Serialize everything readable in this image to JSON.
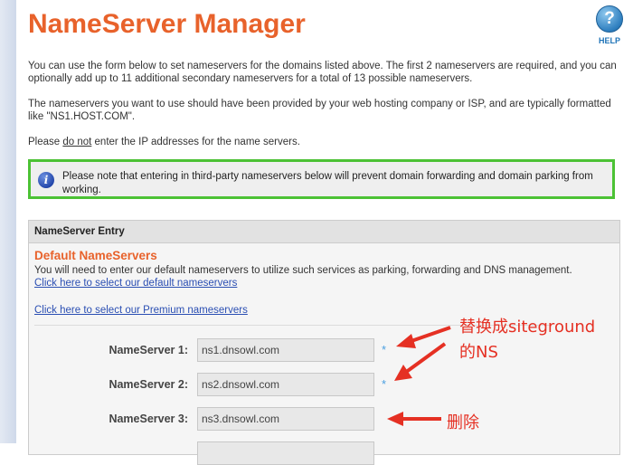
{
  "page": {
    "title": "NameServer Manager",
    "help_label": "HELP",
    "help_glyph": "?"
  },
  "intro": {
    "p1": "You can use the form below to set nameservers for the domains listed above. The first 2 nameservers are required, and you can optionally add up to 11 additional secondary nameservers for a total of 13 possible nameservers.",
    "p2": "The nameservers you want to use should have been provided by your web hosting company or ISP, and are typically formatted like \"NS1.HOST.COM\".",
    "p3_before": "Please ",
    "p3_underlined": "do not",
    "p3_after": " enter the IP addresses for the name servers."
  },
  "note": {
    "icon": "info-icon",
    "text": "Please note that entering in third-party nameservers below will prevent domain forwarding and domain parking from working.",
    "border_color": "#4cc235"
  },
  "panel": {
    "header": "NameServer Entry",
    "section_title": "Default NameServers",
    "section_desc": "You will need to enter our default nameservers to utilize such services as parking, forwarding and DNS management.",
    "link_default": "Click here to select our default nameservers",
    "link_premium": "Click here to select our Premium nameservers",
    "required_marker": "*",
    "nameservers": [
      {
        "label": "NameServer 1:",
        "value": "ns1.dnsowl.com",
        "required": true
      },
      {
        "label": "NameServer 2:",
        "value": "ns2.dnsowl.com",
        "required": true
      },
      {
        "label": "NameServer 3:",
        "value": "ns3.dnsowl.com",
        "required": false
      }
    ]
  },
  "annotations": {
    "replace_line1": "替换成siteground",
    "replace_line2": "的NS",
    "delete": "删除",
    "color": "#e53023"
  },
  "colors": {
    "accent": "#e8622b",
    "link": "#2b4fb3"
  }
}
